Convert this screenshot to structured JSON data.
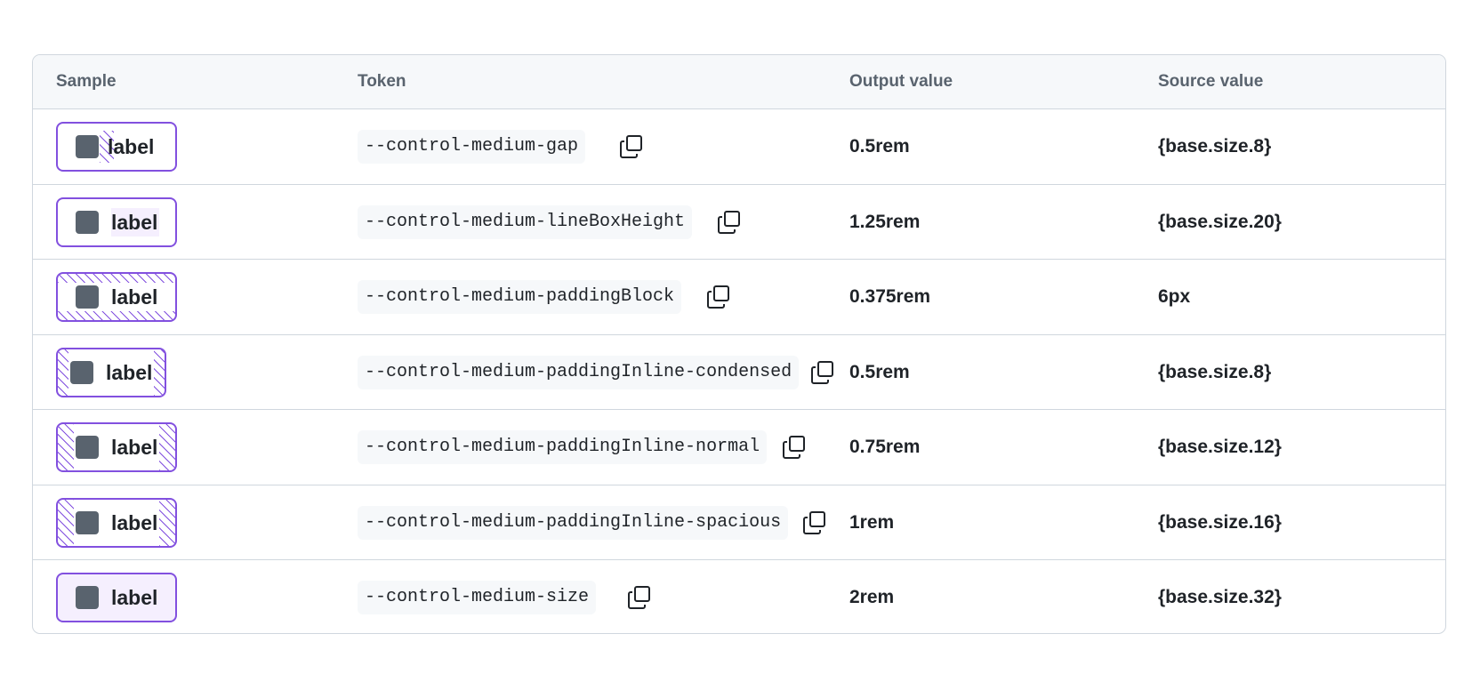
{
  "headers": {
    "sample": "Sample",
    "token": "Token",
    "output": "Output value",
    "source": "Source value"
  },
  "colors": {
    "accent_border": "#8250df",
    "indicator": "#59636e",
    "header_bg": "#f6f8fa",
    "border": "#d0d7de"
  },
  "rows": [
    {
      "sample_label": "label",
      "token": "--control-medium-gap",
      "output": "0.5rem",
      "source": "{base.size.8}",
      "copy_icon": "copy-icon"
    },
    {
      "sample_label": "label",
      "token": "--control-medium-lineBoxHeight",
      "output": "1.25rem",
      "source": "{base.size.20}",
      "copy_icon": "copy-icon"
    },
    {
      "sample_label": "label",
      "token": "--control-medium-paddingBlock",
      "output": "0.375rem",
      "source": "6px",
      "copy_icon": "copy-icon"
    },
    {
      "sample_label": "label",
      "token": "--control-medium-paddingInline-condensed",
      "output": "0.5rem",
      "source": "{base.size.8}",
      "copy_icon": "copy-icon"
    },
    {
      "sample_label": "label",
      "token": "--control-medium-paddingInline-normal",
      "output": "0.75rem",
      "source": "{base.size.12}",
      "copy_icon": "copy-icon"
    },
    {
      "sample_label": "label",
      "token": "--control-medium-paddingInline-spacious",
      "output": "1rem",
      "source": "{base.size.16}",
      "copy_icon": "copy-icon"
    },
    {
      "sample_label": "label",
      "token": "--control-medium-size",
      "output": "2rem",
      "source": "{base.size.32}",
      "copy_icon": "copy-icon"
    }
  ]
}
